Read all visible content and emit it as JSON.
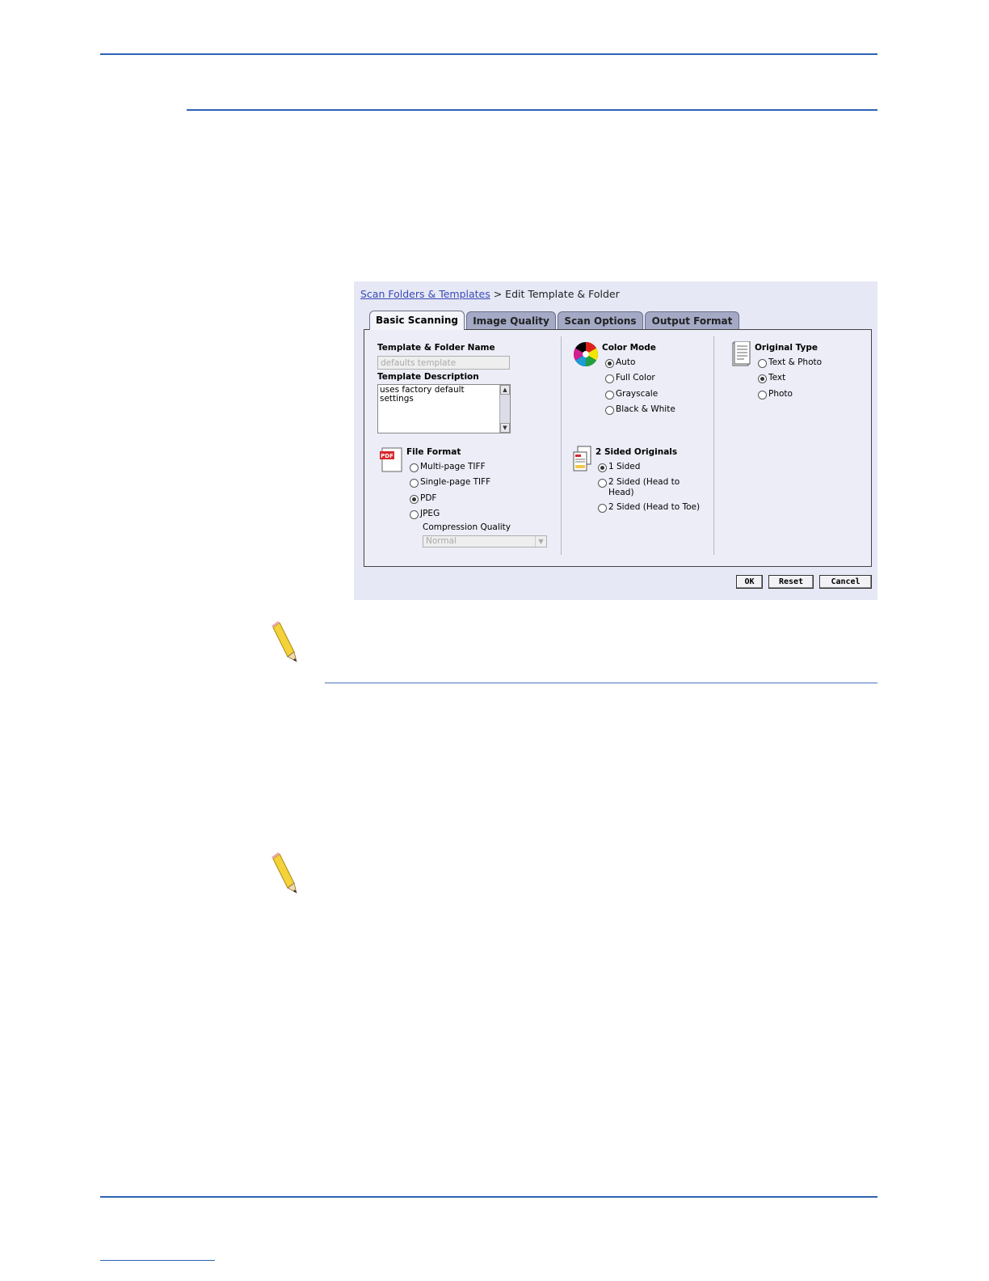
{
  "breadcrumb": {
    "link": "Scan Folders & Templates",
    "separator": " > ",
    "current": "Edit Template & Folder"
  },
  "tabs": [
    {
      "label": "Basic Scanning",
      "active": true
    },
    {
      "label": "Image Quality",
      "active": false
    },
    {
      "label": "Scan Options",
      "active": false
    },
    {
      "label": "Output Format",
      "active": false
    }
  ],
  "template": {
    "name_label": "Template & Folder Name",
    "name_value": "defaults template",
    "description_label": "Template Description",
    "description_value": "uses factory default settings"
  },
  "file_format": {
    "label": "File Format",
    "icon_text": "PDF",
    "options": [
      "Multi-page TIFF",
      "Single-page TIFF",
      "PDF",
      "JPEG"
    ],
    "selected": "PDF",
    "compression_label": "Compression Quality",
    "compression_value": "Normal"
  },
  "color_mode": {
    "label": "Color Mode",
    "options": [
      "Auto",
      "Full Color",
      "Grayscale",
      "Black & White"
    ],
    "selected": "Auto"
  },
  "two_sided": {
    "label": "2 Sided Originals",
    "options": [
      "1 Sided",
      "2 Sided (Head to Head)",
      "2 Sided (Head to Toe)"
    ],
    "selected": "1 Sided"
  },
  "original_type": {
    "label": "Original Type",
    "options": [
      "Text & Photo",
      "Text",
      "Photo"
    ],
    "selected": "Text"
  },
  "buttons": {
    "ok": "OK",
    "reset": "Reset",
    "cancel": "Cancel"
  },
  "colors": {
    "rule": "#2b63b6",
    "tab": "#a4a9c6",
    "panel": "#ecedf7"
  }
}
